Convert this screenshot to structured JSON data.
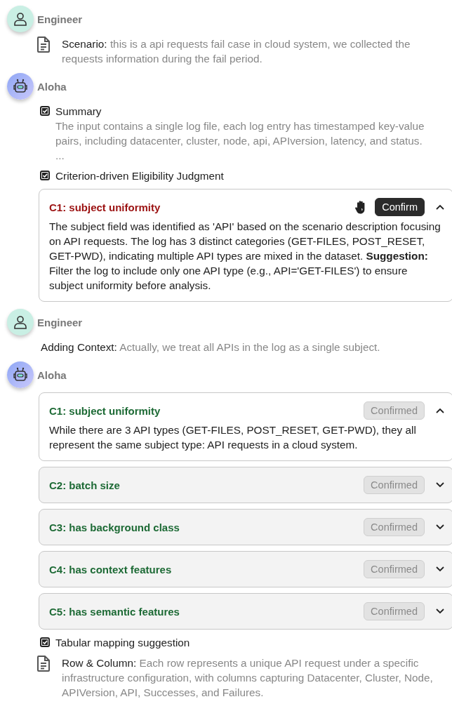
{
  "messages": [
    {
      "kind": "engineer",
      "author": "Engineer",
      "items": [
        {
          "kind": "note",
          "label": "Scenario:",
          "text": "this is a api requests fail case in cloud system, we collected the requests information during the fail period."
        }
      ]
    },
    {
      "kind": "aloha",
      "author": "Aloha",
      "items": [
        {
          "kind": "section",
          "checked": true,
          "title": "Summary",
          "text": "The input contains a single log file, each log entry has timestamped key-value pairs, including datacenter, cluster, node, api, APIversion, latency, and status.",
          "more": "..."
        },
        {
          "kind": "section",
          "checked": true,
          "title": "Criterion-driven Eligibility Judgment"
        },
        {
          "kind": "criterion",
          "title": "C1: subject uniformity",
          "passed": false,
          "flagged": true,
          "expanded": true,
          "button": {
            "label": "Confirm",
            "disabled": false
          },
          "body": "The subject field was identified as 'API' based on the scenario description focusing on API requests. The log has 3 distinct categories (GET-FILES, POST_RESET, GET-PWD), indicating multiple API types are mixed in the dataset. **Suggestion:** Filter the log to include only one API type (e.g., API='GET-FILES') to ensure subject uniformity before analysis."
        }
      ]
    },
    {
      "kind": "engineer",
      "author": "Engineer",
      "items": [
        {
          "kind": "context",
          "label": "Adding Context:",
          "text": "Actually, we treat all APIs in the log as a single subject."
        }
      ]
    },
    {
      "kind": "aloha",
      "author": "Aloha",
      "items": [
        {
          "kind": "criterion",
          "title": "C1: subject uniformity",
          "passed": true,
          "flagged": false,
          "expanded": true,
          "button": {
            "label": "Confirmed",
            "disabled": true
          },
          "body": "While there are 3 API types (GET-FILES, POST_RESET, GET-PWD), they all represent the same subject type: API requests in a cloud system."
        },
        {
          "kind": "criterion",
          "title": "C2: batch size",
          "passed": true,
          "flagged": false,
          "expanded": false,
          "button": {
            "label": "Confirmed",
            "disabled": true
          }
        },
        {
          "kind": "criterion",
          "title": "C3: has background class",
          "passed": true,
          "flagged": false,
          "expanded": false,
          "button": {
            "label": "Confirmed",
            "disabled": true
          }
        },
        {
          "kind": "criterion",
          "title": "C4: has context features",
          "passed": true,
          "flagged": false,
          "expanded": false,
          "button": {
            "label": "Confirmed",
            "disabled": true
          }
        },
        {
          "kind": "criterion",
          "title": "C5: has semantic features",
          "passed": true,
          "flagged": false,
          "expanded": false,
          "button": {
            "label": "Confirmed",
            "disabled": true
          }
        },
        {
          "kind": "section",
          "checked": true,
          "title": "Tabular mapping suggestion"
        },
        {
          "kind": "note",
          "label": "Row & Column:",
          "text": "Each row represents a unique API request under a specific infrastructure configuration, with columns capturing Datacenter, Cluster, Node, APIVersion, API, Successes, and Failures."
        }
      ]
    }
  ]
}
